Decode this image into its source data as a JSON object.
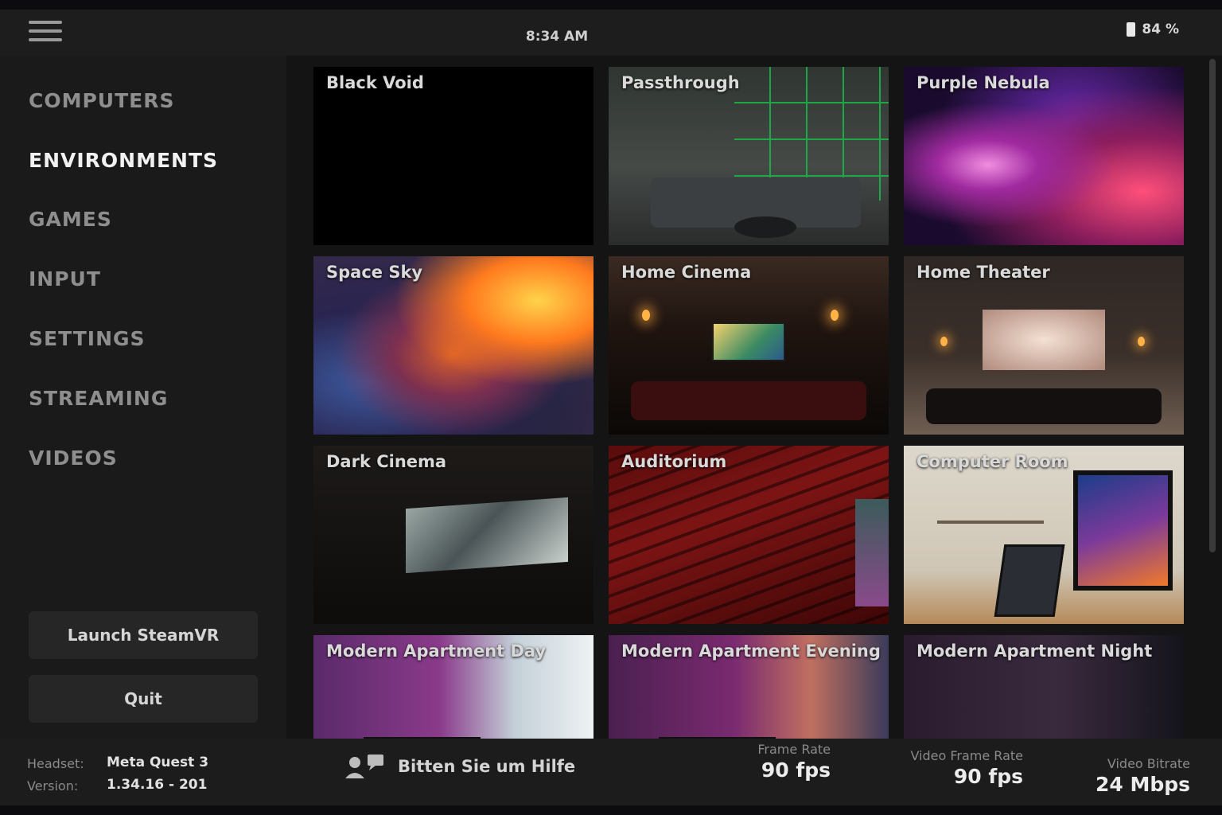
{
  "header": {
    "time": "8:34 AM",
    "battery": "84 %"
  },
  "sidebar": {
    "items": [
      {
        "label": "COMPUTERS"
      },
      {
        "label": "ENVIRONMENTS"
      },
      {
        "label": "GAMES"
      },
      {
        "label": "INPUT"
      },
      {
        "label": "SETTINGS"
      },
      {
        "label": "STREAMING"
      },
      {
        "label": "VIDEOS"
      }
    ],
    "active": "ENVIRONMENTS",
    "launch_label": "Launch SteamVR",
    "quit_label": "Quit"
  },
  "environments": [
    {
      "title": "Black Void"
    },
    {
      "title": "Passthrough"
    },
    {
      "title": "Purple Nebula"
    },
    {
      "title": "Space Sky",
      "selected": true
    },
    {
      "title": "Home Cinema"
    },
    {
      "title": "Home Theater"
    },
    {
      "title": "Dark Cinema"
    },
    {
      "title": "Auditorium"
    },
    {
      "title": "Computer Room"
    },
    {
      "title": "Modern Apartment Day"
    },
    {
      "title": "Modern Apartment Evening"
    },
    {
      "title": "Modern Apartment Night"
    }
  ],
  "footer": {
    "headset_label": "Headset:",
    "headset_value": "Meta Quest 3",
    "version_label": "Version:",
    "version_value": "1.34.16 - 201",
    "help_label": "Bitten Sie um Hilfe",
    "frame_rate_label": "Frame Rate",
    "frame_rate_value": "90 fps",
    "video_frame_rate_label": "Video Frame Rate",
    "video_frame_rate_value": "90 fps",
    "video_bitrate_label": "Video Bitrate",
    "video_bitrate_value": "24 Mbps"
  },
  "icons": {
    "menu": "hamburger-menu-icon",
    "battery": "battery-icon",
    "help": "help-person-icon"
  },
  "colors": {
    "background": "#141414",
    "active_text": "#f2f2f2",
    "inactive_text": "#8e8e8e",
    "passthrough_grid": "#18c04a"
  }
}
